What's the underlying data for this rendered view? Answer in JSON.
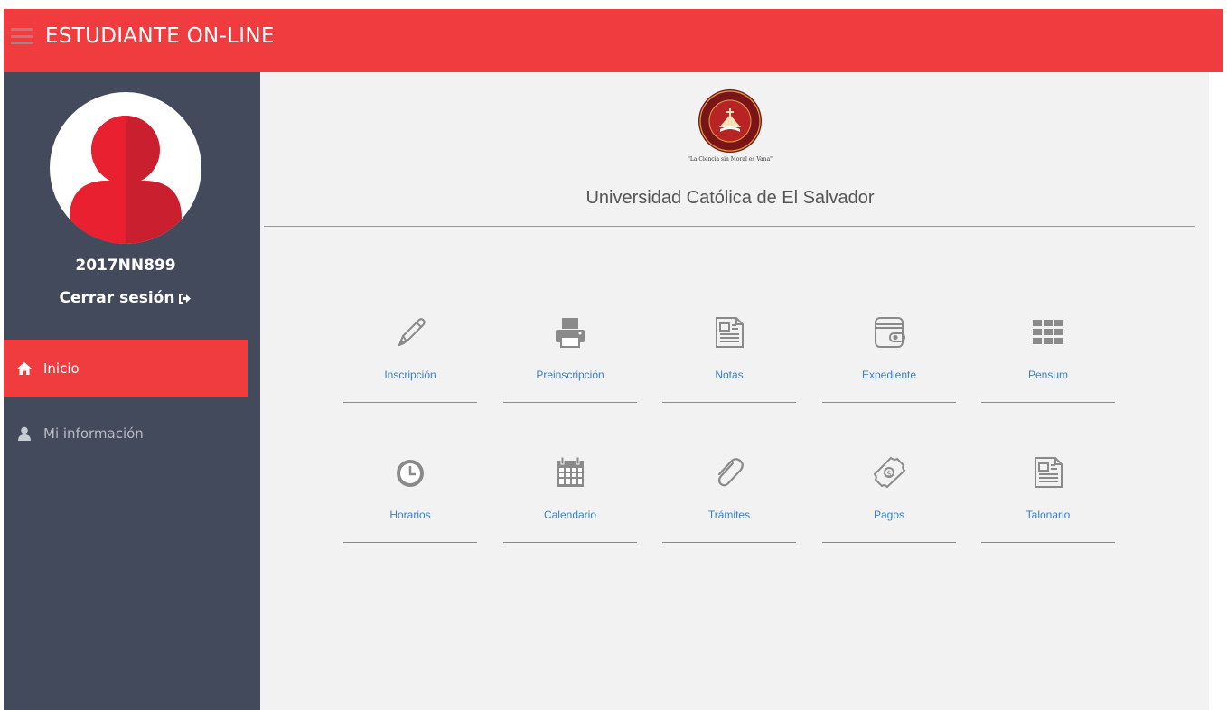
{
  "header": {
    "title": "ESTUDIANTE ON-LINE"
  },
  "sidebar": {
    "user_id": "2017NN899",
    "logout_label": "Cerrar sesión",
    "items": [
      {
        "label": "Inicio",
        "icon": "home-icon",
        "active": true
      },
      {
        "label": "Mi información",
        "icon": "user-icon",
        "active": false
      }
    ]
  },
  "main": {
    "motto": "\"La Ciencia sin Moral es Vana\"",
    "university_name": "Universidad Católica de El Salvador",
    "tiles_row1": [
      {
        "label": "Inscripción",
        "icon": "pencil-icon"
      },
      {
        "label": "Preinscripción",
        "icon": "printer-icon"
      },
      {
        "label": "Notas",
        "icon": "newspaper-icon"
      },
      {
        "label": "Expediente",
        "icon": "wallet-icon"
      },
      {
        "label": "Pensum",
        "icon": "grid-icon"
      }
    ],
    "tiles_row2": [
      {
        "label": "Horarios",
        "icon": "clock-icon"
      },
      {
        "label": "Calendario",
        "icon": "calendar-icon"
      },
      {
        "label": "Trámites",
        "icon": "paperclip-icon"
      },
      {
        "label": "Pagos",
        "icon": "money-icon"
      },
      {
        "label": "Talonario",
        "icon": "newspaper-icon"
      }
    ]
  },
  "colors": {
    "accent": "#f13c3f",
    "sidebar": "#434a5b",
    "link": "#3a7fc4",
    "icon": "#8a8a8a"
  }
}
